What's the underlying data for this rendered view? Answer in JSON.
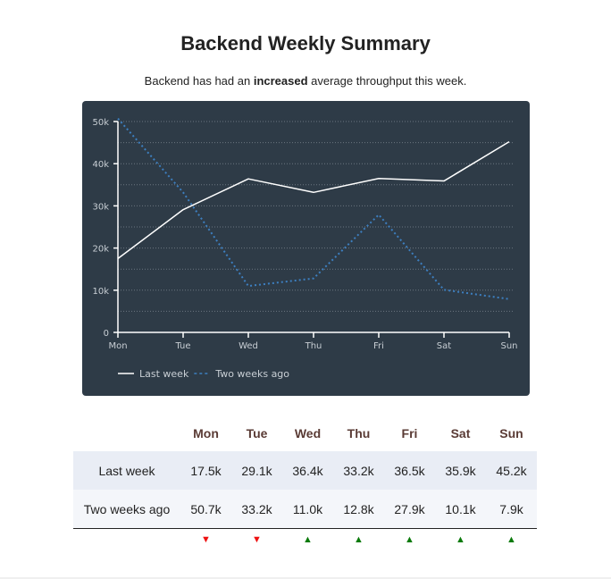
{
  "header": {
    "title": "Backend Weekly Summary",
    "subtitle_pre": "Backend has had an ",
    "subtitle_bold": "increased",
    "subtitle_post": " average throughput this week."
  },
  "colors": {
    "chart_background": "#2e3b47",
    "last_week_line": "#ffffff",
    "two_weeks_line": "#3d7fc0",
    "up_arrow": "#0a7a0a",
    "down_arrow": "#ee1111",
    "table_header": "#5a3b35"
  },
  "chart_data": {
    "type": "line",
    "title": "",
    "xlabel": "",
    "ylabel": "",
    "categories": [
      "Mon",
      "Tue",
      "Wed",
      "Thu",
      "Fri",
      "Sat",
      "Sun"
    ],
    "y_ticks": [
      0,
      10000,
      20000,
      30000,
      40000,
      50000
    ],
    "y_tick_labels": [
      "0",
      "10k",
      "20k",
      "30k",
      "40k",
      "50k"
    ],
    "ylim": [
      0,
      50000
    ],
    "grid": true,
    "legend_position": "bottom-left",
    "series": [
      {
        "name": "Last week",
        "style": "solid",
        "values": [
          17500,
          29100,
          36400,
          33200,
          36500,
          35900,
          45200
        ]
      },
      {
        "name": "Two weeks ago",
        "style": "dashed",
        "values": [
          50700,
          33200,
          11000,
          12800,
          27900,
          10100,
          7900
        ]
      }
    ]
  },
  "table": {
    "columns": [
      "",
      "Mon",
      "Tue",
      "Wed",
      "Thu",
      "Fri",
      "Sat",
      "Sun"
    ],
    "rows": [
      {
        "label": "Last week",
        "cells": [
          "17.5k",
          "29.1k",
          "36.4k",
          "33.2k",
          "36.5k",
          "35.9k",
          "45.2k"
        ]
      },
      {
        "label": "Two weeks ago",
        "cells": [
          "50.7k",
          "33.2k",
          "11.0k",
          "12.8k",
          "27.9k",
          "10.1k",
          "7.9k"
        ]
      }
    ],
    "trend": [
      {
        "direction": "down",
        "glyph": "▼"
      },
      {
        "direction": "down",
        "glyph": "▼"
      },
      {
        "direction": "up",
        "glyph": "▲"
      },
      {
        "direction": "up",
        "glyph": "▲"
      },
      {
        "direction": "up",
        "glyph": "▲"
      },
      {
        "direction": "up",
        "glyph": "▲"
      },
      {
        "direction": "up",
        "glyph": "▲"
      }
    ]
  }
}
